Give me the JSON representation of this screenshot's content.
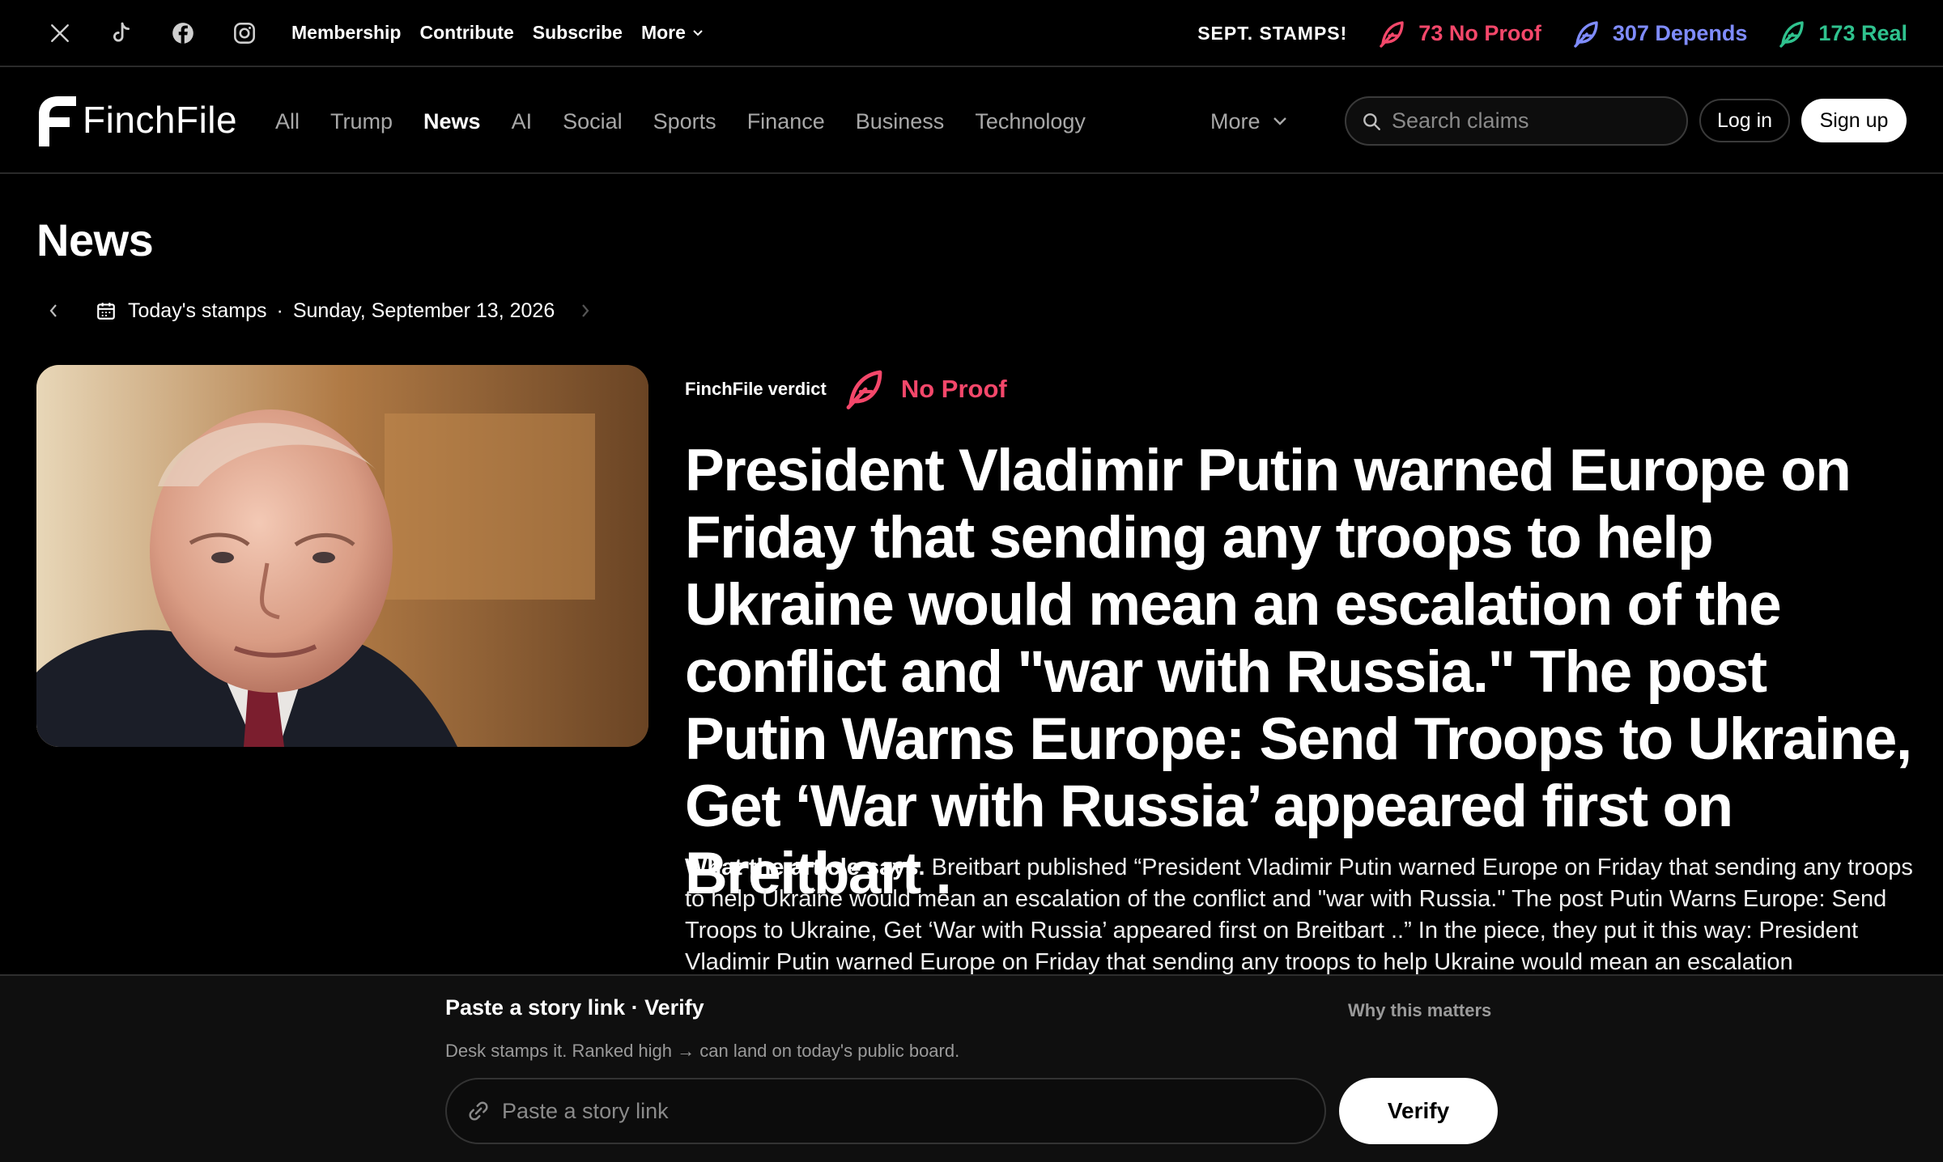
{
  "topbar": {
    "social": [
      "x-icon",
      "tiktok-icon",
      "facebook-icon",
      "instagram-icon"
    ],
    "links": {
      "membership": "Membership",
      "contribute": "Contribute",
      "subscribe": "Subscribe",
      "more": "More"
    },
    "stamps_label": "SEPT. STAMPS!",
    "stamps": [
      {
        "count": "73 No Proof",
        "color": "#f4476a",
        "icon": "feather-icon"
      },
      {
        "count": "307 Depends",
        "color": "#7f8cff",
        "icon": "feather-icon"
      },
      {
        "count": "173 Real",
        "color": "#2fc28e",
        "icon": "feather-icon"
      }
    ]
  },
  "nav": {
    "logo": "FinchFile",
    "categories": [
      "All",
      "Trump",
      "News",
      "AI",
      "Social",
      "Sports",
      "Finance",
      "Business",
      "Technology"
    ],
    "active_category": "News",
    "more": "More",
    "search_placeholder": "Search claims",
    "login": "Log in",
    "signup": "Sign up"
  },
  "page": {
    "title": "News",
    "date_label": "Today's stamps",
    "date_sep": "·",
    "date": "Sunday, September 13, 2026"
  },
  "article": {
    "verdict_label": "FinchFile verdict",
    "verdict": "No Proof",
    "verdict_color": "#f4476a",
    "headline": "President Vladimir Putin warned Europe on Friday that sending any troops to help Ukraine would mean an escalation of the conflict and \"war with Russia.\" The post Putin Warns Europe: Send Troops to Ukraine, Get ‘War with Russia’ appeared first on Breitbart .",
    "summary_lead": "What the article says.",
    "summary_body": " Breitbart published “President Vladimir Putin warned Europe on Friday that sending any troops to help Ukraine would mean an escalation of the conflict and \"war with Russia.\" The post Putin Warns Europe: Send Troops to Ukraine, Get ‘War with Russia’ appeared first on Breitbart ..” In the piece, they put it this way: President Vladimir Putin warned Europe on Friday that sending any troops to help Ukraine would mean an escalation"
  },
  "dock": {
    "title": "Paste a story link · Verify",
    "why": "Why this matters",
    "subtitle": "Desk stamps it. Ranked high → can land on today's public board.",
    "input_placeholder": "Paste a story link",
    "button": "Verify"
  }
}
